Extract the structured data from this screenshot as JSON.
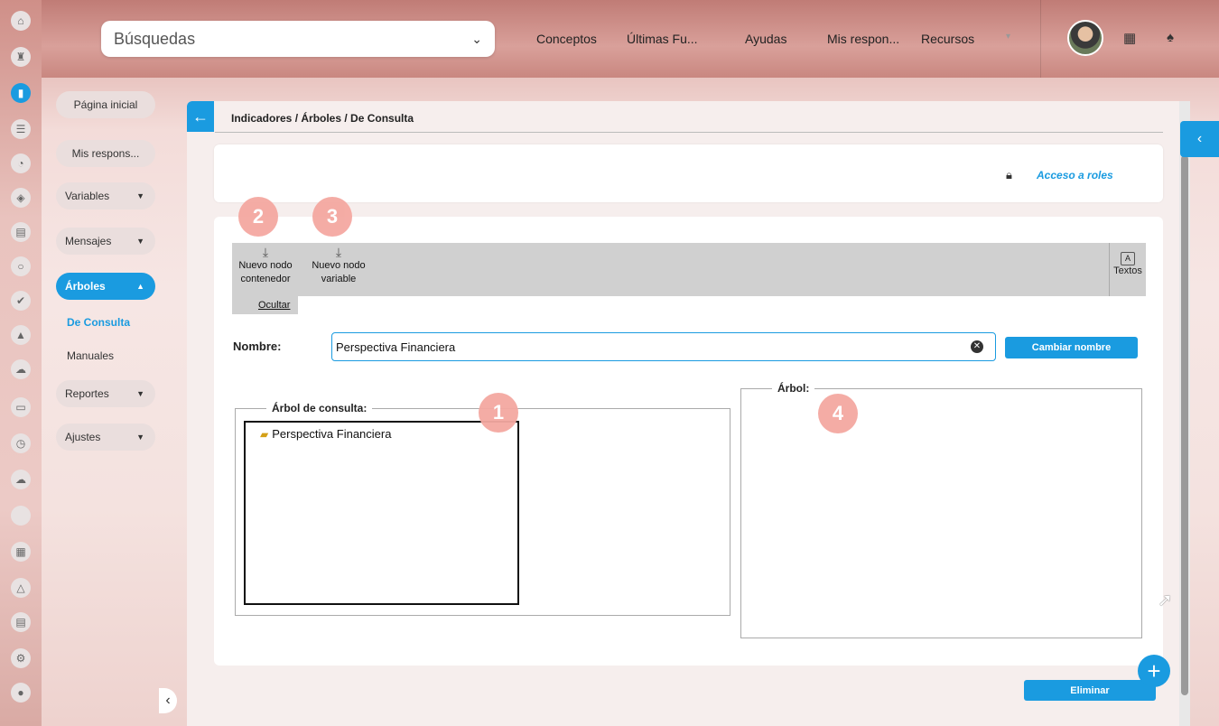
{
  "topbar": {
    "search_placeholder": "Búsquedas",
    "nav": [
      "Conceptos",
      "Últimas Fu...",
      "Ayudas",
      "Mis respon...",
      "Recursos"
    ]
  },
  "rail_icons": [
    "home-icon",
    "tower-icon",
    "chart-icon",
    "list-icon",
    "pie-icon",
    "shield-icon",
    "database-icon",
    "circle-icon",
    "check-icon",
    "warning-icon",
    "cloud-small-icon",
    "monitor-icon",
    "clock-icon",
    "cloud-icon",
    "blank-icon",
    "calendar-icon",
    "triangle-icon",
    "document-icon",
    "gear-icon",
    "bulb-icon"
  ],
  "sidebar": {
    "items": [
      {
        "label": "Página inicial"
      },
      {
        "label": "Mis respons..."
      },
      {
        "label": "Variables"
      },
      {
        "label": "Mensajes"
      },
      {
        "label": "Árboles"
      },
      {
        "label": "Reportes"
      },
      {
        "label": "Ajustes"
      }
    ],
    "sub": [
      "De Consulta",
      "Manuales"
    ]
  },
  "breadcrumb": "Indicadores / Árboles / De Consulta",
  "access_roles": "Acceso a roles",
  "toolbar": {
    "nuevo_contenedor_1": "Nuevo nodo",
    "nuevo_contenedor_2": "contenedor",
    "nuevo_variable_1": "Nuevo nodo",
    "nuevo_variable_2": "variable",
    "ocultar": "Ocultar",
    "textos_icon": "A",
    "textos": "Textos"
  },
  "badges": [
    "1",
    "2",
    "3",
    "4"
  ],
  "form": {
    "nombre_label": "Nombre:",
    "nombre_value": "Perspectiva Financiera",
    "rename": "Cambiar nombre"
  },
  "arbol_consulta": {
    "legend": "Árbol de consulta:",
    "node": "Perspectiva Financiera"
  },
  "arbol": {
    "legend": "Árbol:"
  },
  "eliminar": "Eliminar",
  "colors": {
    "accent": "#1a9be0",
    "badge": "#f4a8a1"
  }
}
